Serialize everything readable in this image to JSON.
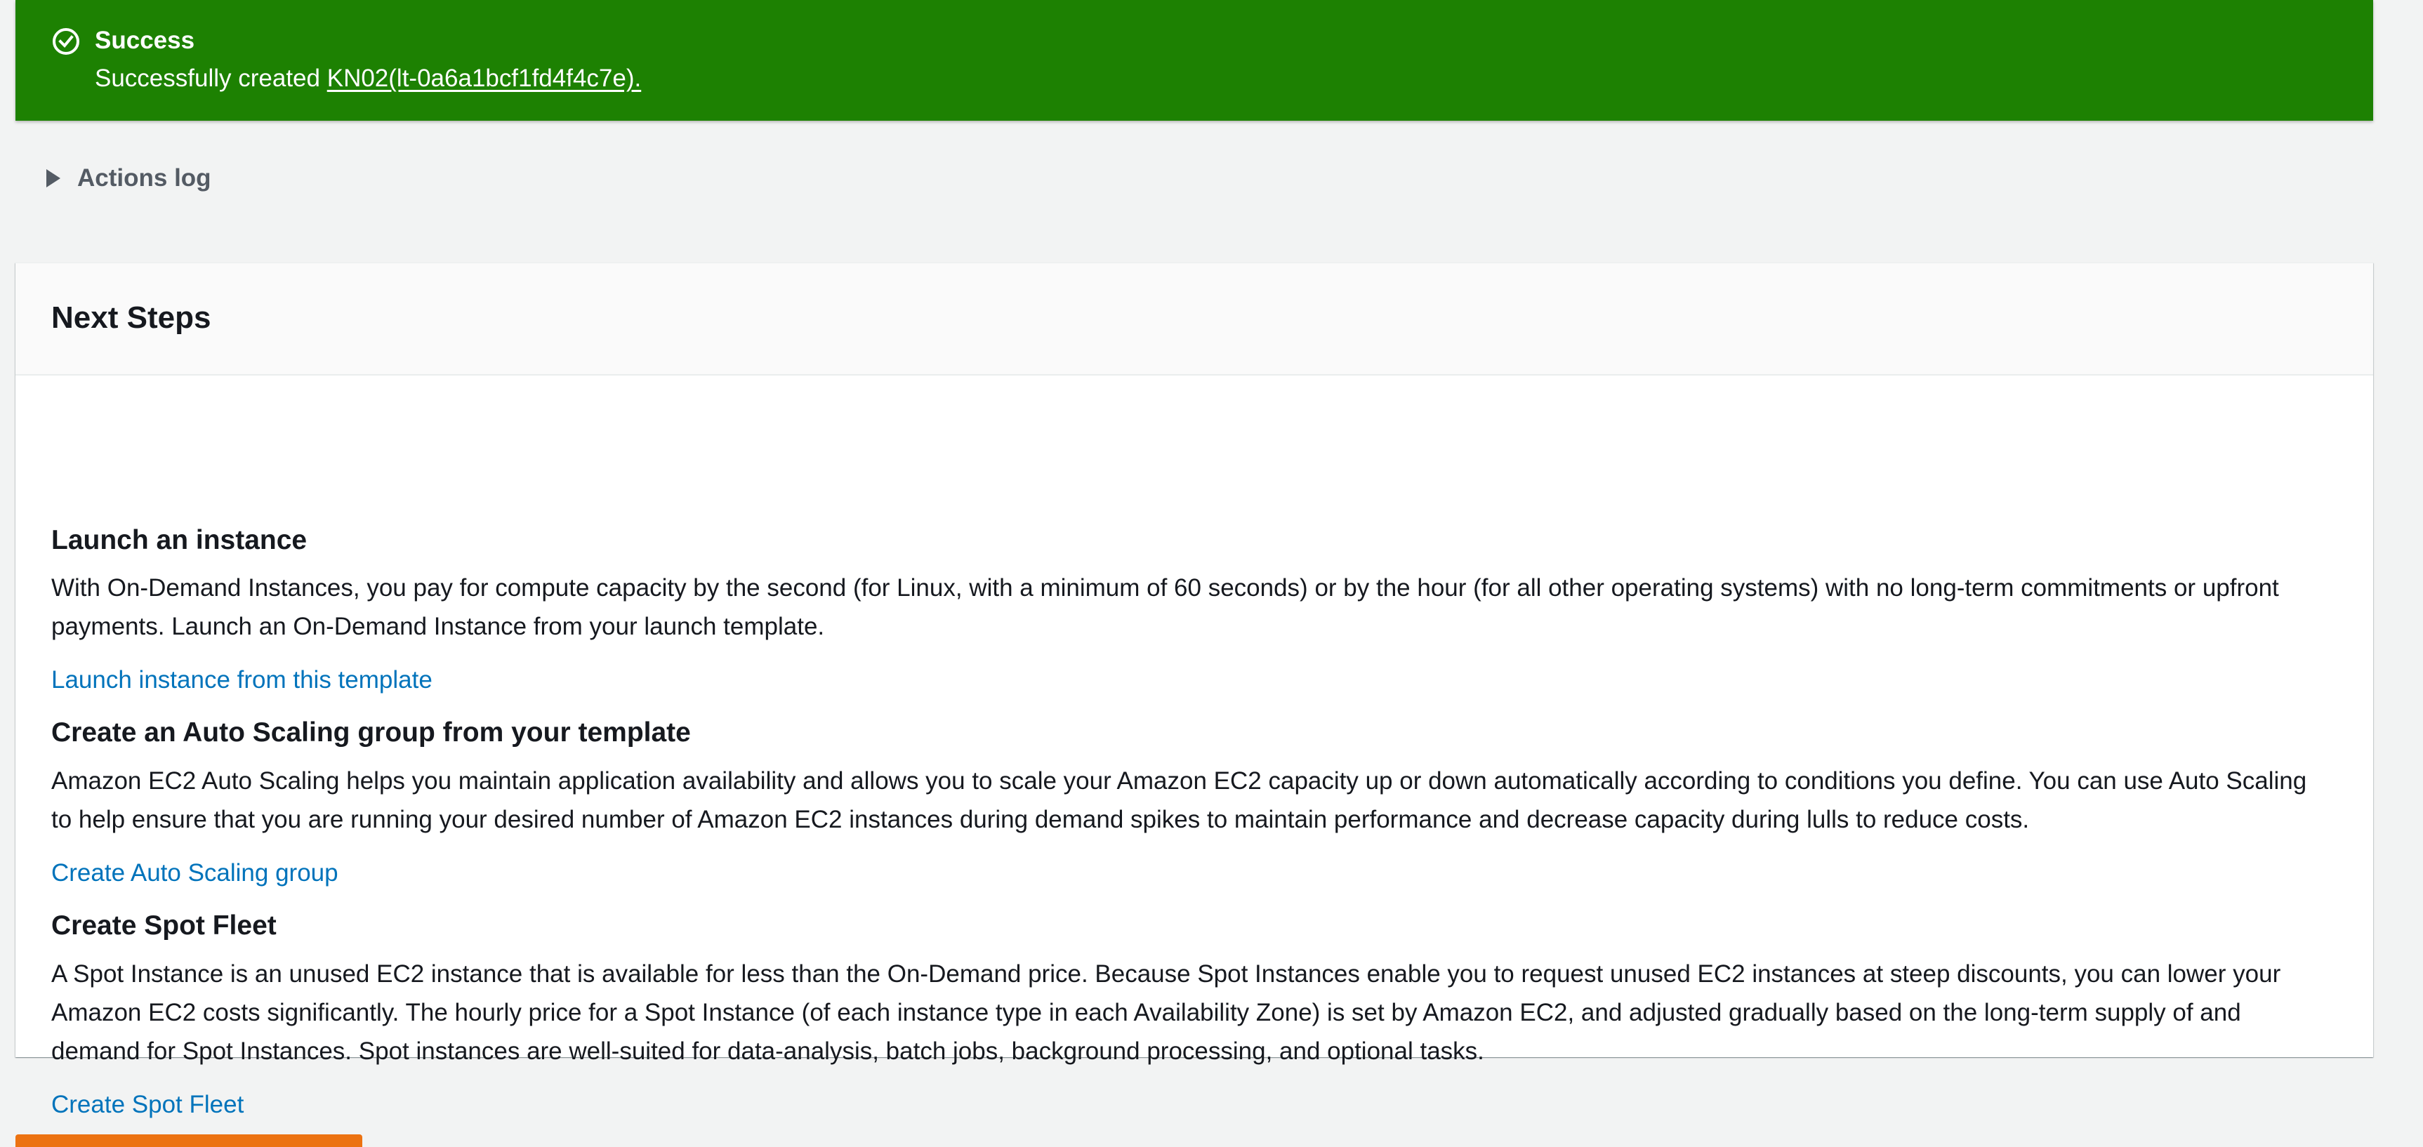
{
  "flash": {
    "header": "Success",
    "message_prefix": "Successfully created ",
    "link_text": "KN02(lt-0a6a1bcf1fd4f4c7e).",
    "background_color": "#1d8102",
    "icon": "check-circle-icon"
  },
  "actions_log": {
    "label": "Actions log",
    "icon": "caret-right-icon"
  },
  "next_steps": {
    "title": "Next Steps",
    "sections": [
      {
        "title": "Launch an instance",
        "text": "With On-Demand Instances, you pay for compute capacity by the second (for Linux, with a minimum of 60 seconds) or by the hour (for all other operating systems) with no long-term commitments or upfront payments. Launch an On-Demand Instance from your launch template.",
        "link": "Launch instance from this template"
      },
      {
        "title": "Create an Auto Scaling group from your template",
        "text": "Amazon EC2 Auto Scaling helps you maintain application availability and allows you to scale your Amazon EC2 capacity up or down automatically according to conditions you define. You can use Auto Scaling to help ensure that you are running your desired number of Amazon EC2 instances during demand spikes to maintain performance and decrease capacity during lulls to reduce costs.",
        "link": "Create Auto Scaling group"
      },
      {
        "title": "Create Spot Fleet",
        "text": "A Spot Instance is an unused EC2 instance that is available for less than the On-Demand price. Because Spot Instances enable you to request unused EC2 instances at steep discounts, you can lower your Amazon EC2 costs significantly. The hourly price for a Spot Instance (of each instance type in each Availability Zone) is set by Amazon EC2, and adjusted gradually based on the long-term supply of and demand for Spot Instances. Spot instances are well-suited for data-analysis, batch jobs, background processing, and optional tasks.",
        "link": "Create Spot Fleet"
      }
    ]
  },
  "colors": {
    "link": "#0073bb",
    "page_background": "#f2f3f3",
    "primary_button": "#ec7211"
  }
}
